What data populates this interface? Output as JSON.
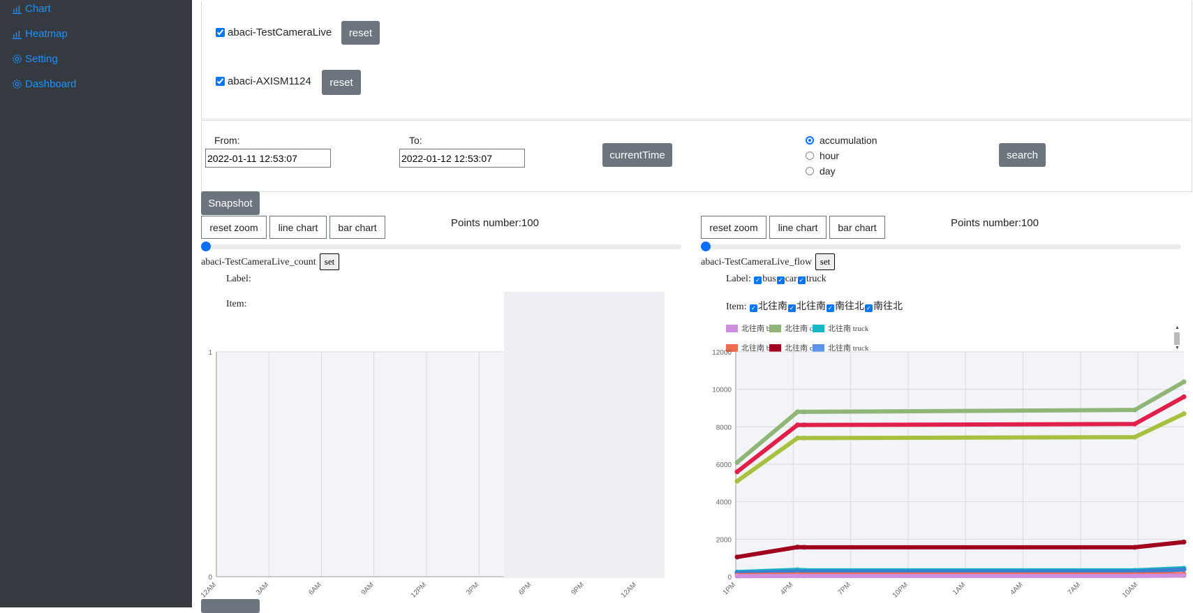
{
  "sidebar": {
    "items": [
      {
        "label": "Chart",
        "icon": "bar-chart-icon"
      },
      {
        "label": "Heatmap",
        "icon": "bar-chart-icon"
      },
      {
        "label": "Setting",
        "icon": "gear-icon"
      },
      {
        "label": "Dashboard",
        "icon": "gear-icon"
      }
    ]
  },
  "cameras": [
    {
      "name": "abaci-TestCameraLive",
      "checked": true,
      "reset_label": "reset"
    },
    {
      "name": "abaci-AXISM1124",
      "checked": true,
      "reset_label": "reset"
    }
  ],
  "filters": {
    "from_label": "From:",
    "from_value": "2022-01-11 12:53:07",
    "to_label": "To:",
    "to_value": "2022-01-12 12:53:07",
    "current_time_label": "currentTime",
    "search_label": "search",
    "modes": [
      {
        "label": "accumulation",
        "selected": true
      },
      {
        "label": "hour",
        "selected": false
      },
      {
        "label": "day",
        "selected": false
      }
    ]
  },
  "snapshot_label": "Snapshot",
  "left_chart": {
    "reset_zoom": "reset zoom",
    "line_chart": "line chart",
    "bar_chart": "bar chart",
    "points": "Points number:100",
    "title": "abaci-TestCameraLive_count",
    "set_label": "set",
    "label_text": "Label:",
    "item_text": "Item:"
  },
  "right_chart": {
    "reset_zoom": "reset zoom",
    "line_chart": "line chart",
    "bar_chart": "bar chart",
    "points": "Points number:100",
    "title": "abaci-TestCameraLive_flow",
    "set_label": "set",
    "label_text": "Label:",
    "labels": [
      "bus",
      "car",
      "truck"
    ],
    "item_text": "Item:",
    "items": [
      "北往南",
      "北往南",
      "南往北",
      "南往北"
    ],
    "legend": [
      {
        "line1": "北往南",
        "line2": "bus",
        "color": "#cf8fdf"
      },
      {
        "line1": "北往南",
        "line2": "car",
        "color": "#8fb577"
      },
      {
        "line1": "北往南",
        "line2": "truck",
        "color": "#17b8c4"
      },
      {
        "line1": "北往南",
        "line2": "bus",
        "color": "#f06a4f"
      },
      {
        "line1": "北往南",
        "line2": "car",
        "color": "#a0001e"
      },
      {
        "line1": "北往南",
        "line2": "truck",
        "color": "#5f93ea"
      }
    ]
  },
  "chart_data": [
    {
      "type": "line",
      "title": "",
      "xlabel": "",
      "ylabel": "",
      "x": [
        "12AM",
        "3AM",
        "6AM",
        "9AM",
        "12PM",
        "3PM",
        "6PM",
        "9PM",
        "12AM"
      ],
      "ylim": [
        0,
        1
      ],
      "yticks": [
        "1",
        "0"
      ],
      "series": []
    },
    {
      "type": "line",
      "title": "",
      "xlabel": "",
      "ylabel": "",
      "x": [
        "1PM",
        "4PM",
        "7PM",
        "10PM",
        "1AM",
        "4AM",
        "7AM",
        "10AM"
      ],
      "ylim": [
        0,
        12000
      ],
      "yticks": [
        "12000",
        "10000",
        "8000",
        "6000",
        "4000",
        "2000",
        "0"
      ],
      "series": [
        {
          "color": "#8fb577",
          "values": [
            6100,
            8800,
            8800,
            8900,
            10400
          ]
        },
        {
          "color": "#e0204a",
          "values": [
            5600,
            8100,
            8100,
            8150,
            9600
          ]
        },
        {
          "color": "#a8c040",
          "values": [
            5100,
            7400,
            7400,
            7450,
            8700
          ]
        },
        {
          "color": "#a0001e",
          "values": [
            1050,
            1580,
            1570,
            1570,
            1850
          ]
        },
        {
          "color": "#17b8c4",
          "values": [
            250,
            370,
            340,
            340,
            450
          ]
        },
        {
          "color": "#3a7fd0",
          "values": [
            200,
            290,
            280,
            280,
            380
          ]
        },
        {
          "color": "#f06a4f",
          "values": [
            80,
            110,
            110,
            110,
            140
          ]
        },
        {
          "color": "#cf8fdf",
          "values": [
            30,
            40,
            40,
            40,
            60
          ]
        }
      ]
    }
  ]
}
